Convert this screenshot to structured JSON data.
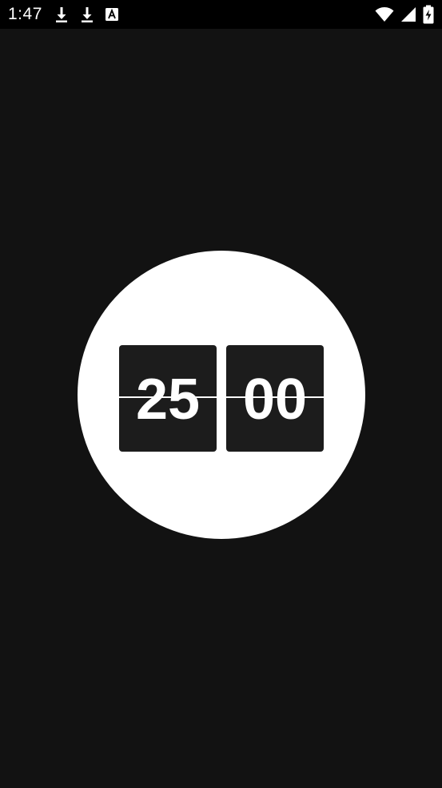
{
  "status_bar": {
    "time": "1:47",
    "notification_icons": [
      "download-icon",
      "download-icon",
      "font-app-icon"
    ],
    "system_icons": [
      "wifi-icon",
      "cellular-signal-icon",
      "battery-charging-icon"
    ]
  },
  "timer": {
    "minutes": "25",
    "seconds": "00"
  },
  "colors": {
    "background": "#121212",
    "status_bar": "#000000",
    "circle": "#ffffff",
    "card": "#1c1c1c",
    "digit": "#ffffff"
  }
}
